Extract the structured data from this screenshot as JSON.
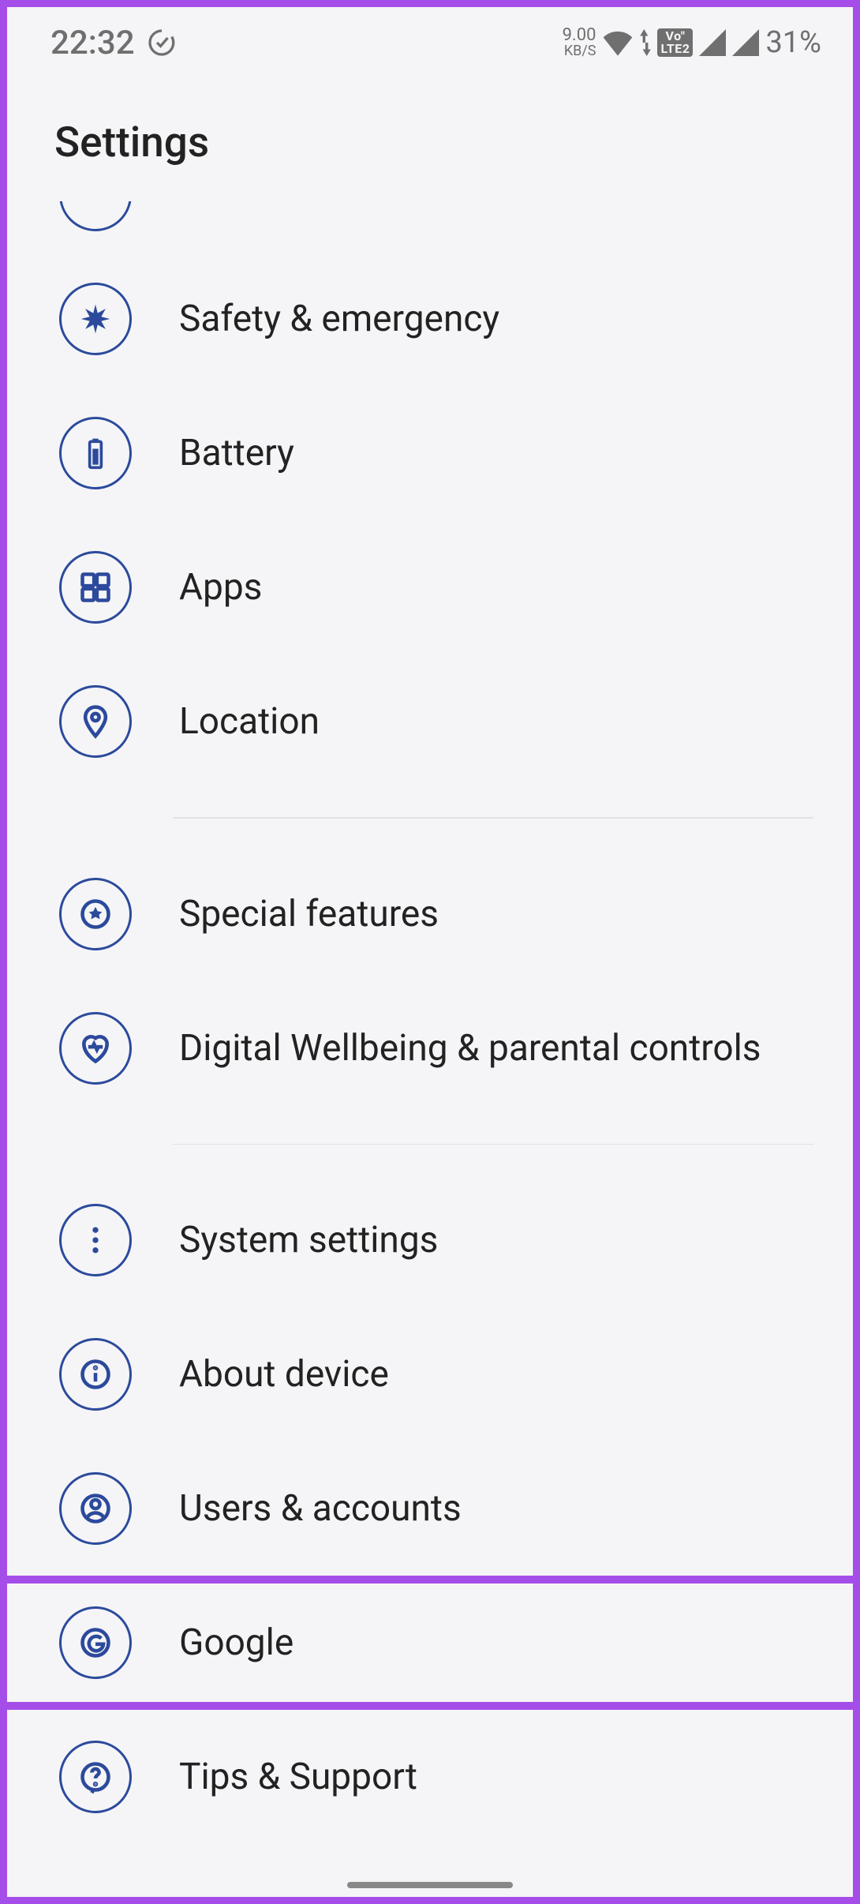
{
  "statusBar": {
    "time": "22:32",
    "netSpeed": {
      "value": "9.00",
      "unit": "KB/S"
    },
    "volte": {
      "top": "Vo",
      "bot": "LTE",
      "num": "2"
    },
    "batteryPercent": "31%"
  },
  "header": {
    "title": "Settings"
  },
  "items": [
    {
      "id": "safety",
      "label": "Safety & emergency",
      "icon": "asterisk"
    },
    {
      "id": "battery",
      "label": "Battery",
      "icon": "battery"
    },
    {
      "id": "apps",
      "label": "Apps",
      "icon": "apps"
    },
    {
      "id": "location",
      "label": "Location",
      "icon": "location"
    },
    {
      "id": "special",
      "label": "Special features",
      "icon": "star-circle"
    },
    {
      "id": "wellbeing",
      "label": "Digital Wellbeing & parental controls",
      "icon": "heart"
    },
    {
      "id": "system",
      "label": "System settings",
      "icon": "dots-vertical"
    },
    {
      "id": "about",
      "label": "About device",
      "icon": "info"
    },
    {
      "id": "users",
      "label": "Users & accounts",
      "icon": "user"
    },
    {
      "id": "google",
      "label": "Google",
      "icon": "google",
      "highlighted": true
    },
    {
      "id": "tips",
      "label": "Tips & Support",
      "icon": "help"
    }
  ]
}
